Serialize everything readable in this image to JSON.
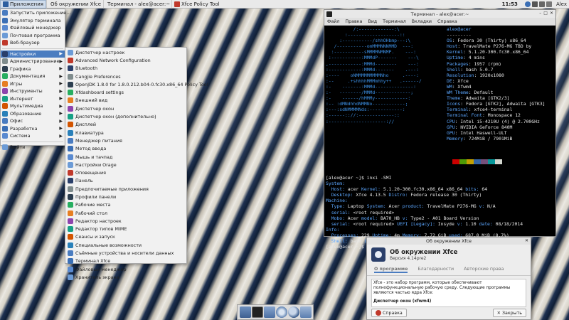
{
  "top_panel": {
    "apps_label": "Приложения",
    "tasks": [
      "Об окружении Xfce",
      "Терминал - alex@acer:~",
      "Xfce Policy Tool"
    ],
    "clock": "11:53",
    "user": "Alex"
  },
  "app_menu": {
    "items": [
      {
        "label": "Запустить приложение...",
        "submenu": false
      },
      {
        "label": "Эмулятор терминала",
        "submenu": false
      },
      {
        "label": "Файловый менеджер",
        "submenu": false
      },
      {
        "label": "Почтовая программа",
        "submenu": false
      },
      {
        "label": "Веб-браузер",
        "submenu": false
      },
      {
        "label": "Настройки",
        "submenu": true
      },
      {
        "label": "Администрирование",
        "submenu": true
      },
      {
        "label": "Графика",
        "submenu": true
      },
      {
        "label": "Документация",
        "submenu": true
      },
      {
        "label": "Игры",
        "submenu": true
      },
      {
        "label": "Инструменты",
        "submenu": true
      },
      {
        "label": "Интернет",
        "submenu": true
      },
      {
        "label": "Мультимедиа",
        "submenu": true
      },
      {
        "label": "Образование",
        "submenu": true
      },
      {
        "label": "Офис",
        "submenu": true
      },
      {
        "label": "Разработка",
        "submenu": true
      },
      {
        "label": "Система",
        "submenu": true
      },
      {
        "label": "Выйти",
        "submenu": false
      }
    ]
  },
  "settings_menu": {
    "items": [
      "Диспетчер настроек",
      "Advanced Network Configuration",
      "Bluetooth",
      "Cangjie Preferences",
      "OpenJDK 1.8.0 for 1.8.0.212.b04-0.fc30.x86_64 Policy Tool",
      "Xfdashboard settings",
      "Внешний вид",
      "Диспетчер окон",
      "Диспетчер окон (дополнительно)",
      "Дисплей",
      "Клавиатура",
      "Менеджер питания",
      "Метод ввода",
      "Мышь и тачпад",
      "Настройки Orage",
      "Оповещения",
      "Панель",
      "Предпочитаемые приложения",
      "Профили панели",
      "Рабочие места",
      "Рабочий стол",
      "Редактор настроек",
      "Редактор типов MIME",
      "Сеансы и запуск",
      "Специальные возможности",
      "Съёмные устройства и носители данных",
      "Терминал Xfce",
      "Файловый менеджер",
      "Хранитель экрана"
    ]
  },
  "terminal": {
    "title": "Терминал - alex@acer:~",
    "menu": [
      "Файл",
      "Правка",
      "Вид",
      "Терминал",
      "Вкладки",
      "Справка"
    ],
    "user_host": "alex@acer",
    "separator": "---------",
    "neofetch": [
      {
        "k": "OS",
        "v": "Fedora 30 (Thirty) x86_64"
      },
      {
        "k": "Host",
        "v": "TravelMate P276-MG TBD by"
      },
      {
        "k": "Kernel",
        "v": "5.1.20-300.fc30.x86_64"
      },
      {
        "k": "Uptime",
        "v": "4 mins"
      },
      {
        "k": "Packages",
        "v": "1957 (rpm)"
      },
      {
        "k": "Shell",
        "v": "bash 5.0.7"
      },
      {
        "k": "Resolution",
        "v": "1920x1080"
      },
      {
        "k": "DE",
        "v": "Xfce"
      },
      {
        "k": "WM",
        "v": "Xfwm4"
      },
      {
        "k": "WM Theme",
        "v": "Default"
      },
      {
        "k": "Theme",
        "v": "Adwaita [GTK2/3]"
      },
      {
        "k": "Icons",
        "v": "Fedora [GTK2], Adwaita [GTK3]"
      },
      {
        "k": "Terminal",
        "v": "xfce4-terminal"
      },
      {
        "k": "Terminal Font",
        "v": "Monospace 12"
      },
      {
        "k": "CPU",
        "v": "Intel i5-4210U (4) @ 2.700GHz"
      },
      {
        "k": "GPU",
        "v": "NVIDIA GeForce 840M"
      },
      {
        "k": "GPU",
        "v": "Intel Haswell-ULT"
      },
      {
        "k": "Memory",
        "v": "724MiB / 7901MiB"
      }
    ],
    "swatches": [
      "#000000",
      "#cc0000",
      "#4e9a06",
      "#c4a000",
      "#3465a4",
      "#75507b",
      "#06989a",
      "#d3d7cf"
    ],
    "prompt1": "[alex@acer ~]$ inxi -SMI",
    "inxi": [
      [
        {
          "k": "System:",
          "v": ""
        }
      ],
      [
        {
          "k": "  Host:",
          "v": " acer "
        },
        {
          "k": "Kernel:",
          "v": " 5.1.20-300.fc30.x86_64 x86_64 "
        },
        {
          "k": "bits:",
          "v": " 64"
        }
      ],
      [
        {
          "k": "  Desktop:",
          "v": " Xfce 4.13.5 "
        },
        {
          "k": "Distro:",
          "v": " Fedora release 30 (Thirty)"
        }
      ],
      [
        {
          "k": "Machine:",
          "v": ""
        }
      ],
      [
        {
          "k": "  Type:",
          "v": " Laptop "
        },
        {
          "k": "System:",
          "v": " Acer "
        },
        {
          "k": "product:",
          "v": " TravelMate P276-MG "
        },
        {
          "k": "v:",
          "v": " N/A"
        }
      ],
      [
        {
          "k": "  serial:",
          "v": " <root required>"
        }
      ],
      [
        {
          "k": "  Mobo:",
          "v": " Acer "
        },
        {
          "k": "model:",
          "v": " BA70_HB "
        },
        {
          "k": "v:",
          "v": " Type2 - A01 Board Version"
        }
      ],
      [
        {
          "k": "  serial:",
          "v": " <root required> "
        },
        {
          "k": "UEFI [Legacy]:",
          "v": " Insyde "
        },
        {
          "k": "v:",
          "v": " 1.10 "
        },
        {
          "k": "date:",
          "v": " 08/18/2014"
        }
      ],
      [
        {
          "k": "Info:",
          "v": ""
        }
      ],
      [
        {
          "k": "  Processes:",
          "v": " 229 "
        },
        {
          "k": "Uptime:",
          "v": " 4m "
        },
        {
          "k": "Memory:",
          "v": " 7.72 GiB "
        },
        {
          "k": "used:",
          "v": " 687.0 MiB (8.7%)"
        }
      ],
      [
        {
          "k": "  Shell:",
          "v": " bash "
        },
        {
          "k": "inxi:",
          "v": " 3.0.35"
        }
      ]
    ],
    "prompt2": "[alex@acer ~]$ "
  },
  "about": {
    "title": "Об окружении Xfce",
    "name": "Об окружении Xfce",
    "version": "Версия 4.14pre2",
    "tabs": [
      "О программе",
      "Благодарности",
      "Авторские права"
    ],
    "text": "Xfce - это набор программ, которые обеспечивают полнофункциональную рабочую среду. Следующие программы являются частью ядра Xfce:",
    "section": "Диспетчер окон (xfwm4)",
    "help_label": "Справка",
    "close_label": "Закрыть"
  },
  "colors": {
    "accent": "#4a7cc0",
    "terminal_key": "#5ca7ff",
    "ascii": "#3c8fe3"
  }
}
